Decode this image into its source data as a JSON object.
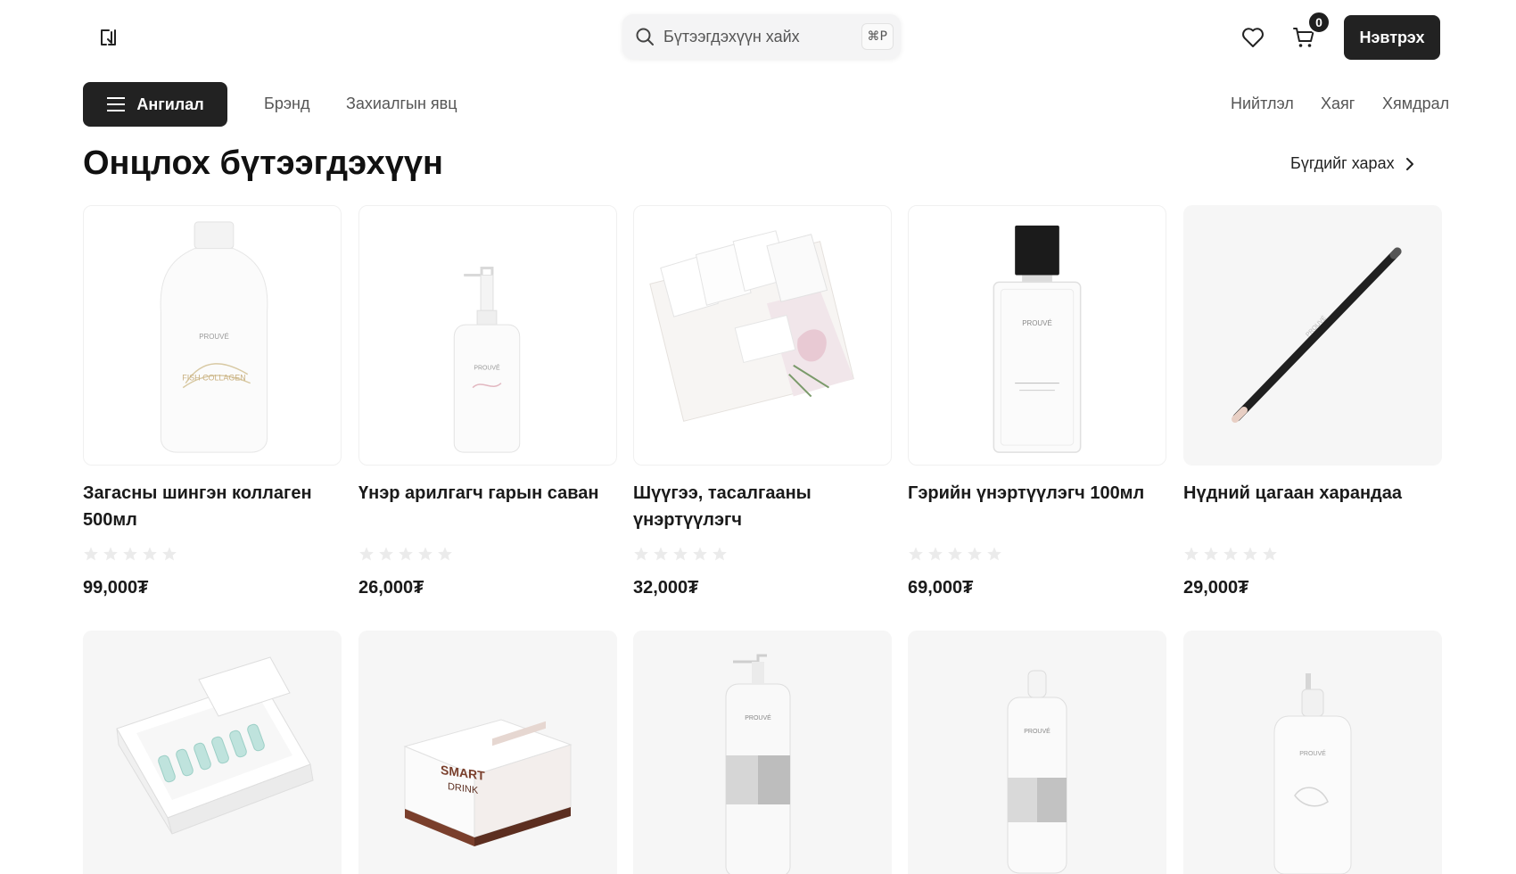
{
  "header": {
    "logo_icon": "store-logo-icon",
    "search_placeholder": "Бүтээгдэхүүн хайх",
    "search_shortcut": "⌘P",
    "cart_count": "0",
    "login_label": "Нэвтрэх"
  },
  "nav": {
    "category_label": "Ангилал",
    "links_left": [
      "Брэнд",
      "Захиалгын явц"
    ],
    "links_right": [
      "Нийтлэл",
      "Хаяг",
      "Хямдрал"
    ]
  },
  "section": {
    "title": "Онцлох бүтээгдэхүүн",
    "see_all": "Бүгдийг харах"
  },
  "products": [
    {
      "name": "Загасны шингэн коллаген 500мл",
      "price": "99,000₮",
      "rating": 0,
      "image": "collagen-bottle"
    },
    {
      "name": "Үнэр арилгагч гарын саван",
      "price": "26,000₮",
      "rating": 0,
      "image": "hand-soap-pump"
    },
    {
      "name": "Шүүгээ, тасалгааны үнэртүүлэгч",
      "price": "32,000₮",
      "rating": 0,
      "image": "sachets"
    },
    {
      "name": "Гэрийн үнэртүүлэгч 100мл",
      "price": "69,000₮",
      "rating": 0,
      "image": "perfume-bottle"
    },
    {
      "name": "Нүдний цагаан харандаа",
      "price": "29,000₮",
      "rating": 0,
      "image": "eye-pencil"
    }
  ],
  "products_row2": [
    {
      "image": "ampoule-box"
    },
    {
      "image": "smart-drink-box",
      "box_text_1": "SMART",
      "box_text_2": "DRINK"
    },
    {
      "image": "volume-shampoo"
    },
    {
      "image": "volume-spray"
    },
    {
      "image": "hand-mask-bottle"
    }
  ],
  "colors": {
    "accent": "#222222",
    "star": "#ebebeb",
    "card_bg": "#f6f6f6"
  }
}
